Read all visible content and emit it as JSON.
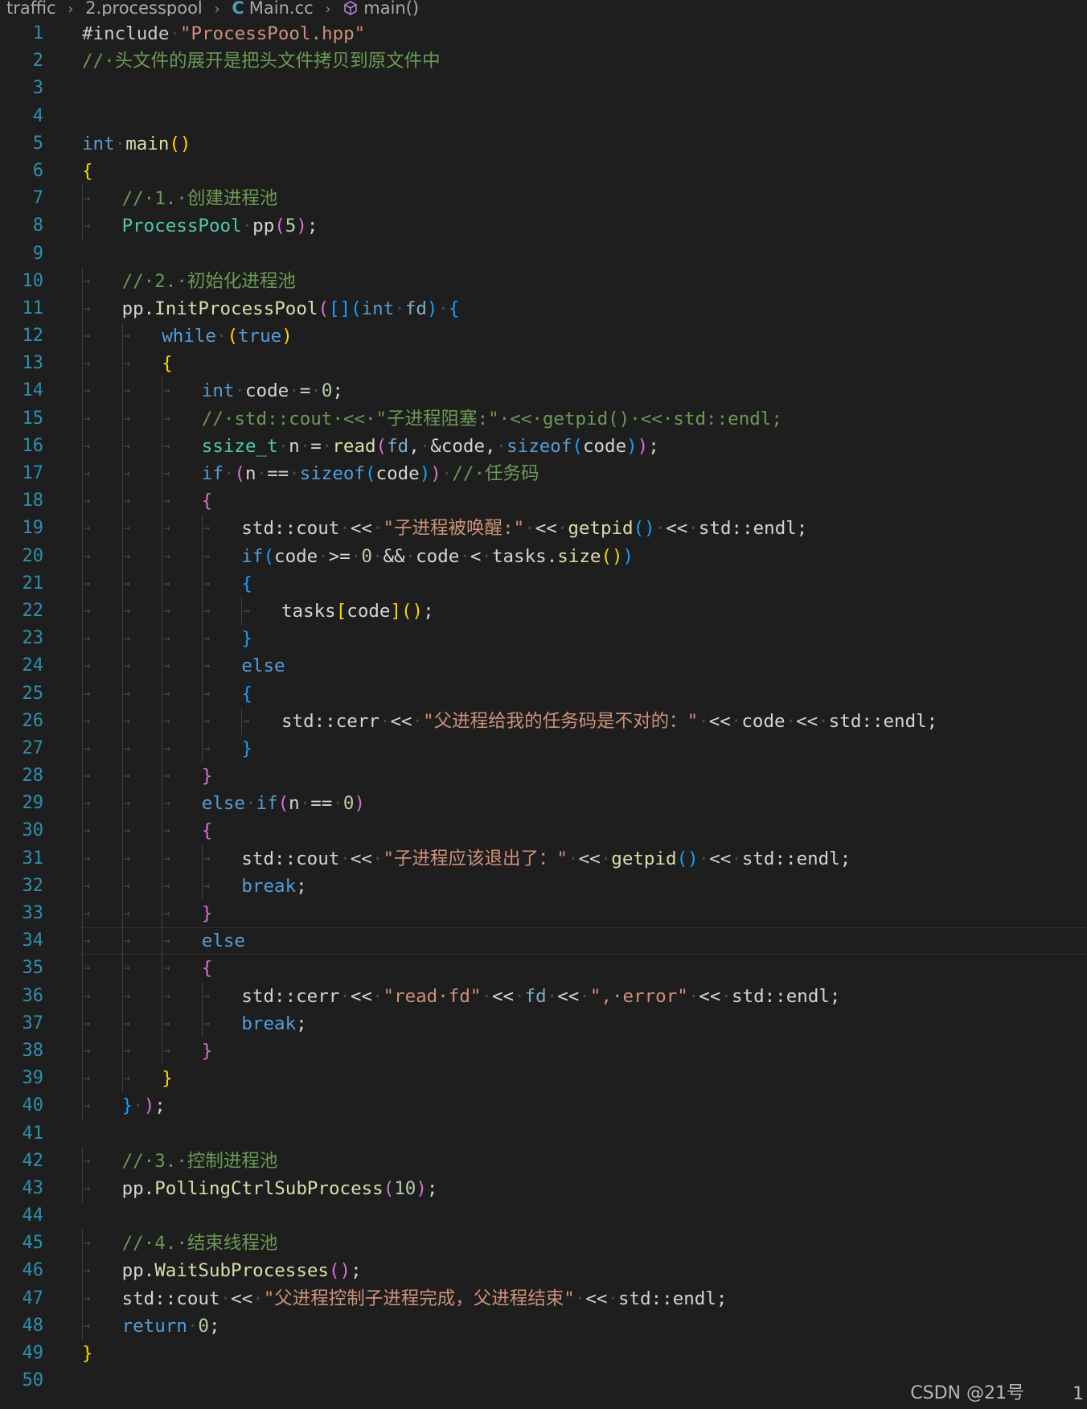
{
  "breadcrumb": {
    "folder1": "traffic",
    "folder2": "2.processpool",
    "file": "Main.cc",
    "file_icon": "C",
    "symbol": "main()"
  },
  "editor": {
    "current_line": 34,
    "lines": [
      {
        "n": "1",
        "indent": 0,
        "tokens": [
          [
            "pp",
            "#include"
          ],
          [
            "ws",
            "·"
          ],
          [
            "str",
            "\"ProcessPool.hpp\""
          ]
        ]
      },
      {
        "n": "2",
        "indent": 0,
        "tokens": [
          [
            "cmt",
            "//·头文件的展开是把头文件拷贝到原文件中"
          ]
        ]
      },
      {
        "n": "3",
        "indent": 0,
        "tokens": []
      },
      {
        "n": "4",
        "indent": 0,
        "tokens": []
      },
      {
        "n": "5",
        "indent": 0,
        "tokens": [
          [
            "kw",
            "int"
          ],
          [
            "ws",
            "·"
          ],
          [
            "fn",
            "main"
          ],
          [
            "b1",
            "()"
          ]
        ]
      },
      {
        "n": "6",
        "indent": 0,
        "tokens": [
          [
            "b1",
            "{"
          ]
        ]
      },
      {
        "n": "7",
        "indent": 1,
        "tokens": [
          [
            "cmt",
            "//·1.·创建进程池"
          ]
        ]
      },
      {
        "n": "8",
        "indent": 1,
        "tokens": [
          [
            "typ",
            "ProcessPool"
          ],
          [
            "ws",
            "·"
          ],
          [
            "",
            "pp"
          ],
          [
            "b2",
            "("
          ],
          [
            "num",
            "5"
          ],
          [
            "b2",
            ")"
          ],
          [
            "",
            ";"
          ]
        ]
      },
      {
        "n": "9",
        "indent": 0,
        "tokens": []
      },
      {
        "n": "10",
        "indent": 1,
        "tokens": [
          [
            "cmt",
            "//·2.·初始化进程池"
          ]
        ]
      },
      {
        "n": "11",
        "indent": 1,
        "tokens": [
          [
            "",
            "pp."
          ],
          [
            "fn",
            "InitProcessPool"
          ],
          [
            "b2",
            "("
          ],
          [
            "b3",
            "[]"
          ],
          [
            "b3",
            "("
          ],
          [
            "kw",
            "int"
          ],
          [
            "ws",
            "·"
          ],
          [
            "par",
            "fd"
          ],
          [
            "b3",
            ")"
          ],
          [
            "ws",
            "·"
          ],
          [
            "b3",
            "{"
          ]
        ]
      },
      {
        "n": "12",
        "indent": 2,
        "tokens": [
          [
            "ctl",
            "while"
          ],
          [
            "ws",
            "·"
          ],
          [
            "b1",
            "("
          ],
          [
            "kw",
            "true"
          ],
          [
            "b1",
            ")"
          ]
        ]
      },
      {
        "n": "13",
        "indent": 2,
        "tokens": [
          [
            "b1",
            "{"
          ]
        ]
      },
      {
        "n": "14",
        "indent": 3,
        "tokens": [
          [
            "kw",
            "int"
          ],
          [
            "ws",
            "·"
          ],
          [
            "",
            "code"
          ],
          [
            "ws",
            "·"
          ],
          [
            "",
            "="
          ],
          [
            "ws",
            "·"
          ],
          [
            "num",
            "0"
          ],
          [
            "",
            ";"
          ]
        ]
      },
      {
        "n": "15",
        "indent": 3,
        "tokens": [
          [
            "cmt",
            "//·std::cout·<<·\"子进程阻塞:\"·<<·getpid()·<<·std::endl;"
          ]
        ]
      },
      {
        "n": "16",
        "indent": 3,
        "tokens": [
          [
            "typ",
            "ssize_t"
          ],
          [
            "ws",
            "·"
          ],
          [
            "",
            "n"
          ],
          [
            "ws",
            "·"
          ],
          [
            "",
            "="
          ],
          [
            "ws",
            "·"
          ],
          [
            "fn",
            "read"
          ],
          [
            "b2",
            "("
          ],
          [
            "par",
            "fd"
          ],
          [
            "",
            ","
          ],
          [
            "ws",
            "·"
          ],
          [
            "",
            "&code,"
          ],
          [
            "ws",
            "·"
          ],
          [
            "kw",
            "sizeof"
          ],
          [
            "b3",
            "("
          ],
          [
            "",
            "code"
          ],
          [
            "b3",
            ")"
          ],
          [
            "b2",
            ")"
          ],
          [
            "",
            ";"
          ]
        ]
      },
      {
        "n": "17",
        "indent": 3,
        "tokens": [
          [
            "ctl",
            "if"
          ],
          [
            "ws",
            "·"
          ],
          [
            "b2",
            "("
          ],
          [
            "",
            "n"
          ],
          [
            "ws",
            "·"
          ],
          [
            "",
            "=="
          ],
          [
            "ws",
            "·"
          ],
          [
            "kw",
            "sizeof"
          ],
          [
            "b3",
            "("
          ],
          [
            "",
            "code"
          ],
          [
            "b3",
            ")"
          ],
          [
            "b2",
            ")"
          ],
          [
            "ws",
            "·"
          ],
          [
            "cmt",
            "//·任务码"
          ]
        ]
      },
      {
        "n": "18",
        "indent": 3,
        "tokens": [
          [
            "b2",
            "{"
          ]
        ]
      },
      {
        "n": "19",
        "indent": 4,
        "tokens": [
          [
            "",
            "std::cout"
          ],
          [
            "ws",
            "·"
          ],
          [
            "",
            "<<"
          ],
          [
            "ws",
            "·"
          ],
          [
            "str",
            "\"子进程被唤醒:\""
          ],
          [
            "ws",
            "·"
          ],
          [
            "",
            "<<"
          ],
          [
            "ws",
            "·"
          ],
          [
            "fn",
            "getpid"
          ],
          [
            "b3",
            "()"
          ],
          [
            "ws",
            "·"
          ],
          [
            "",
            "<<"
          ],
          [
            "ws",
            "·"
          ],
          [
            "",
            "std::endl;"
          ]
        ]
      },
      {
        "n": "20",
        "indent": 4,
        "tokens": [
          [
            "ctl",
            "if"
          ],
          [
            "b3",
            "("
          ],
          [
            "",
            "code"
          ],
          [
            "ws",
            "·"
          ],
          [
            "",
            ">="
          ],
          [
            "ws",
            "·"
          ],
          [
            "num",
            "0"
          ],
          [
            "ws",
            "·"
          ],
          [
            "",
            "&&"
          ],
          [
            "ws",
            "·"
          ],
          [
            "",
            "code"
          ],
          [
            "ws",
            "·"
          ],
          [
            "",
            "<"
          ],
          [
            "ws",
            "·"
          ],
          [
            "",
            "tasks."
          ],
          [
            "fn",
            "size"
          ],
          [
            "b1",
            "()"
          ],
          [
            "b3",
            ")"
          ]
        ]
      },
      {
        "n": "21",
        "indent": 4,
        "tokens": [
          [
            "b3",
            "{"
          ]
        ]
      },
      {
        "n": "22",
        "indent": 5,
        "tokens": [
          [
            "",
            "tasks"
          ],
          [
            "b1",
            "["
          ],
          [
            "",
            "code"
          ],
          [
            "b1",
            "]"
          ],
          [
            "b1",
            "()"
          ],
          [
            "",
            ";"
          ]
        ]
      },
      {
        "n": "23",
        "indent": 4,
        "tokens": [
          [
            "b3",
            "}"
          ]
        ]
      },
      {
        "n": "24",
        "indent": 4,
        "tokens": [
          [
            "ctl",
            "else"
          ]
        ]
      },
      {
        "n": "25",
        "indent": 4,
        "tokens": [
          [
            "b3",
            "{"
          ]
        ]
      },
      {
        "n": "26",
        "indent": 5,
        "tokens": [
          [
            "",
            "std::cerr"
          ],
          [
            "ws",
            "·"
          ],
          [
            "",
            "<<"
          ],
          [
            "ws",
            "·"
          ],
          [
            "str",
            "\"父进程给我的任务码是不对的：\""
          ],
          [
            "ws",
            "·"
          ],
          [
            "",
            "<<"
          ],
          [
            "ws",
            "·"
          ],
          [
            "",
            "code"
          ],
          [
            "ws",
            "·"
          ],
          [
            "",
            "<<"
          ],
          [
            "ws",
            "·"
          ],
          [
            "",
            "std::endl;"
          ]
        ]
      },
      {
        "n": "27",
        "indent": 4,
        "tokens": [
          [
            "b3",
            "}"
          ]
        ]
      },
      {
        "n": "28",
        "indent": 3,
        "tokens": [
          [
            "b2",
            "}"
          ]
        ]
      },
      {
        "n": "29",
        "indent": 3,
        "tokens": [
          [
            "ctl",
            "else"
          ],
          [
            "ws",
            "·"
          ],
          [
            "ctl",
            "if"
          ],
          [
            "b2",
            "("
          ],
          [
            "",
            "n"
          ],
          [
            "ws",
            "·"
          ],
          [
            "",
            "=="
          ],
          [
            "ws",
            "·"
          ],
          [
            "num",
            "0"
          ],
          [
            "b2",
            ")"
          ]
        ]
      },
      {
        "n": "30",
        "indent": 3,
        "tokens": [
          [
            "b2",
            "{"
          ]
        ]
      },
      {
        "n": "31",
        "indent": 4,
        "tokens": [
          [
            "",
            "std::cout"
          ],
          [
            "ws",
            "·"
          ],
          [
            "",
            "<<"
          ],
          [
            "ws",
            "·"
          ],
          [
            "str",
            "\"子进程应该退出了：\""
          ],
          [
            "ws",
            "·"
          ],
          [
            "",
            "<<"
          ],
          [
            "ws",
            "·"
          ],
          [
            "fn",
            "getpid"
          ],
          [
            "b3",
            "()"
          ],
          [
            "ws",
            "·"
          ],
          [
            "",
            "<<"
          ],
          [
            "ws",
            "·"
          ],
          [
            "",
            "std::endl;"
          ]
        ]
      },
      {
        "n": "32",
        "indent": 4,
        "tokens": [
          [
            "ctl",
            "break"
          ],
          [
            "",
            ";"
          ]
        ]
      },
      {
        "n": "33",
        "indent": 3,
        "tokens": [
          [
            "b2",
            "}"
          ]
        ]
      },
      {
        "n": "34",
        "indent": 3,
        "tokens": [
          [
            "ctl",
            "else"
          ]
        ]
      },
      {
        "n": "35",
        "indent": 3,
        "tokens": [
          [
            "b2",
            "{"
          ]
        ]
      },
      {
        "n": "36",
        "indent": 4,
        "tokens": [
          [
            "",
            "std::cerr"
          ],
          [
            "ws",
            "·"
          ],
          [
            "",
            "<<"
          ],
          [
            "ws",
            "·"
          ],
          [
            "str",
            "\"read·fd\""
          ],
          [
            "ws",
            "·"
          ],
          [
            "",
            "<<"
          ],
          [
            "ws",
            "·"
          ],
          [
            "par",
            "fd"
          ],
          [
            "ws",
            "·"
          ],
          [
            "",
            "<<"
          ],
          [
            "ws",
            "·"
          ],
          [
            "str",
            "\",·error\""
          ],
          [
            "ws",
            "·"
          ],
          [
            "",
            "<<"
          ],
          [
            "ws",
            "·"
          ],
          [
            "",
            "std::endl;"
          ]
        ]
      },
      {
        "n": "37",
        "indent": 4,
        "tokens": [
          [
            "ctl",
            "break"
          ],
          [
            "",
            ";"
          ]
        ]
      },
      {
        "n": "38",
        "indent": 3,
        "tokens": [
          [
            "b2",
            "}"
          ]
        ]
      },
      {
        "n": "39",
        "indent": 2,
        "tokens": [
          [
            "b1",
            "}"
          ]
        ]
      },
      {
        "n": "40",
        "indent": 1,
        "tokens": [
          [
            "b3",
            "}"
          ],
          [
            "ws",
            "·"
          ],
          [
            "b2",
            ")"
          ],
          [
            "",
            ";"
          ]
        ]
      },
      {
        "n": "41",
        "indent": 0,
        "tokens": []
      },
      {
        "n": "42",
        "indent": 1,
        "tokens": [
          [
            "cmt",
            "//·3.·控制进程池"
          ]
        ]
      },
      {
        "n": "43",
        "indent": 1,
        "tokens": [
          [
            "",
            "pp."
          ],
          [
            "fn",
            "PollingCtrlSubProcess"
          ],
          [
            "b2",
            "("
          ],
          [
            "num",
            "10"
          ],
          [
            "b2",
            ")"
          ],
          [
            "",
            ";"
          ]
        ]
      },
      {
        "n": "44",
        "indent": 0,
        "tokens": []
      },
      {
        "n": "45",
        "indent": 1,
        "tokens": [
          [
            "cmt",
            "//·4.·结束线程池"
          ]
        ]
      },
      {
        "n": "46",
        "indent": 1,
        "tokens": [
          [
            "",
            "pp."
          ],
          [
            "fn",
            "WaitSubProcesses"
          ],
          [
            "b2",
            "()"
          ],
          [
            "",
            ";"
          ]
        ]
      },
      {
        "n": "47",
        "indent": 1,
        "tokens": [
          [
            "",
            "std::cout"
          ],
          [
            "ws",
            "·"
          ],
          [
            "",
            "<<"
          ],
          [
            "ws",
            "·"
          ],
          [
            "str",
            "\"父进程控制子进程完成，父进程结束\""
          ],
          [
            "ws",
            "·"
          ],
          [
            "",
            "<<"
          ],
          [
            "ws",
            "·"
          ],
          [
            "",
            "std::endl;"
          ]
        ]
      },
      {
        "n": "48",
        "indent": 1,
        "tokens": [
          [
            "ctl",
            "return"
          ],
          [
            "ws",
            "·"
          ],
          [
            "num",
            "0"
          ],
          [
            "",
            ";"
          ]
        ]
      },
      {
        "n": "49",
        "indent": 0,
        "tokens": [
          [
            "b1",
            "}"
          ]
        ]
      },
      {
        "n": "50",
        "indent": 0,
        "tokens": []
      }
    ]
  },
  "footer": {
    "watermark": "CSDN @21号",
    "corner_number": "1"
  },
  "colors": {
    "background": "#1e1e1e",
    "line_number": "#2b91af",
    "keyword": "#569cd6",
    "type": "#4ec9b0",
    "function": "#dcdcaa",
    "string": "#ce9178",
    "number": "#b5cea8",
    "comment": "#6a9955"
  }
}
